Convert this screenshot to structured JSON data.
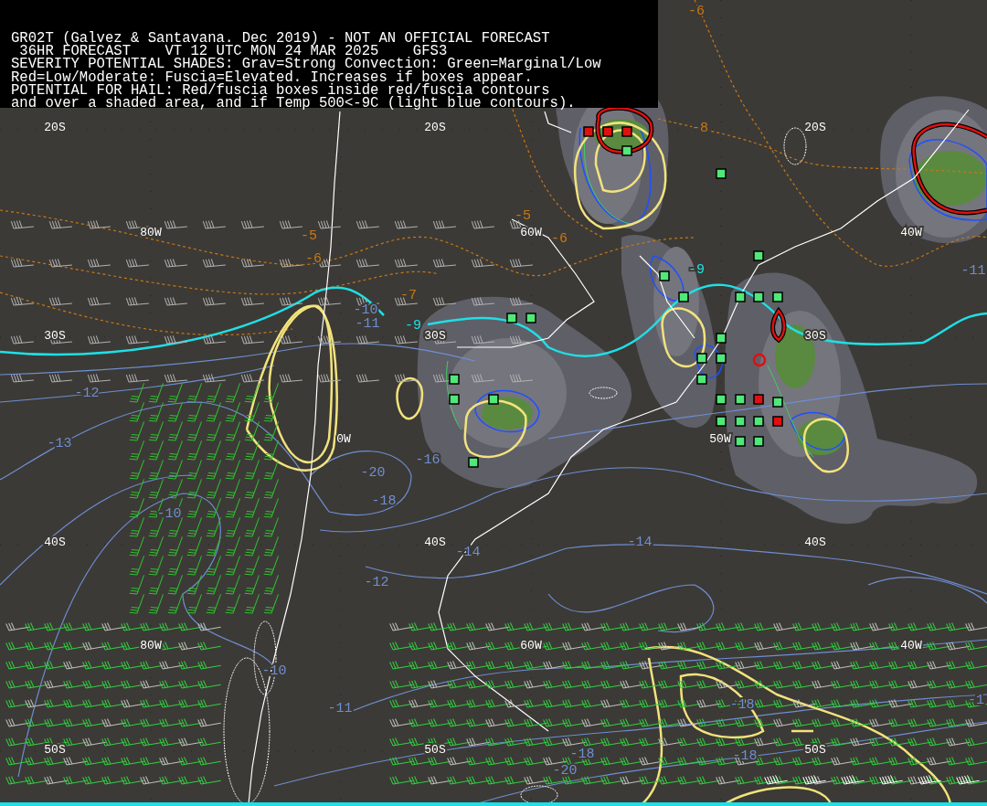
{
  "header": {
    "lines": [
      "GR02T (Galvez & Santavana. Dec 2019) - NOT AN OFFICIAL FORECAST",
      " 36HR FORECAST    VT 12 UTC MON 24 MAR 2025    GFS3",
      "SEVERITY POTENTIAL SHADES: Grav=Strong Convection: Green=Marginal/Low",
      "Red=Low/Moderate: Fuscia=Elevated. Increases if boxes appear.",
      "POTENTIAL FOR HAIL: Red/fuscia boxes inside red/fuscia contours",
      "and over a shaded area, and if Temp 500<-9C (light blue contours)."
    ]
  },
  "map": {
    "grid_labels": [
      "20S",
      "20S",
      "20S",
      "80W",
      "60W",
      "40W",
      "30S",
      "30S",
      "30S",
      "0W",
      "50W",
      "40S",
      "40S",
      "40S",
      "80W",
      "60W",
      "40W",
      "50S",
      "50S",
      "50S"
    ],
    "contour_labels": [
      {
        "text": "-6",
        "color": "#c87814"
      },
      {
        "text": "-8",
        "color": "#c87814"
      },
      {
        "text": "-5",
        "color": "#c87814"
      },
      {
        "text": "-6",
        "color": "#c87814"
      },
      {
        "text": "-7",
        "color": "#c87814"
      },
      {
        "text": "-5",
        "color": "#c87814"
      },
      {
        "text": "-6",
        "color": "#c87814"
      },
      {
        "text": "-9",
        "color": "#1ee0e6"
      },
      {
        "text": "-9",
        "color": "#1ee0e6"
      },
      {
        "text": "-10",
        "color": "#6e8ed2"
      },
      {
        "text": "-11",
        "color": "#6e8ed2"
      },
      {
        "text": "-12",
        "color": "#6e8ed2"
      },
      {
        "text": "-13",
        "color": "#6e8ed2"
      },
      {
        "text": "-16",
        "color": "#6e8ed2"
      },
      {
        "text": "-20",
        "color": "#6e8ed2"
      },
      {
        "text": "-18",
        "color": "#6e8ed2"
      },
      {
        "text": "-10",
        "color": "#6e8ed2"
      },
      {
        "text": "-14",
        "color": "#6e8ed2"
      },
      {
        "text": "-12",
        "color": "#6e8ed2"
      },
      {
        "text": "-14",
        "color": "#6e8ed2"
      },
      {
        "text": "-10",
        "color": "#6e8ed2"
      },
      {
        "text": "-11",
        "color": "#6e8ed2"
      },
      {
        "text": "-18",
        "color": "#6e8ed2"
      },
      {
        "text": "-18",
        "color": "#6e8ed2"
      },
      {
        "text": "-18",
        "color": "#6e8ed2"
      },
      {
        "text": "-20",
        "color": "#6e8ed2"
      },
      {
        "text": "-11",
        "color": "#6e8ed2"
      },
      {
        "text": "-1",
        "color": "#6e8ed2"
      }
    ],
    "markers": [
      {
        "color": "#e01010"
      },
      {
        "color": "#e01010"
      },
      {
        "color": "#e01010"
      },
      {
        "color": "#50e878"
      },
      {
        "color": "#50e878"
      },
      {
        "color": "#50e878"
      },
      {
        "color": "#50e878"
      },
      {
        "color": "#50e878"
      },
      {
        "color": "#50e878"
      },
      {
        "color": "#50e878"
      },
      {
        "color": "#50e878"
      },
      {
        "color": "#50e878"
      },
      {
        "color": "#50e878"
      },
      {
        "color": "#50e878"
      },
      {
        "color": "#50e878"
      },
      {
        "color": "#50e878"
      },
      {
        "color": "#50e878"
      },
      {
        "color": "#50e878"
      },
      {
        "color": "#50e878"
      },
      {
        "color": "#50e878"
      },
      {
        "color": "#50e878"
      },
      {
        "color": "#50e878"
      },
      {
        "color": "#e01010"
      },
      {
        "color": "#50e878"
      },
      {
        "color": "#50e878"
      },
      {
        "color": "#50e878"
      },
      {
        "color": "#e01010"
      },
      {
        "color": "#50e878"
      },
      {
        "color": "#50e878"
      },
      {
        "color": "#50e878"
      },
      {
        "color": "#50e878"
      }
    ]
  }
}
